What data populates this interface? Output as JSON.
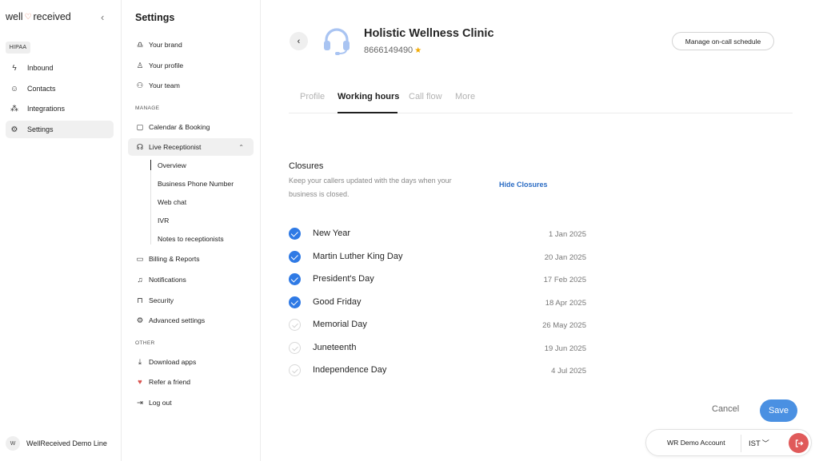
{
  "brand": {
    "logo_text_left": "well",
    "logo_text_right": "received",
    "hipaa": "HIPAA"
  },
  "leftnav": {
    "items": [
      {
        "label": "Inbound",
        "icon": "bolt-icon"
      },
      {
        "label": "Contacts",
        "icon": "smiley-icon"
      },
      {
        "label": "Integrations",
        "icon": "grid-icon"
      },
      {
        "label": "Settings",
        "icon": "gear-icon",
        "active": true
      }
    ],
    "user": {
      "initial": "W",
      "name": "WellReceived Demo Line"
    }
  },
  "settings": {
    "title": "Settings",
    "top_items": [
      "Your brand",
      "Your profile",
      "Your team"
    ],
    "manage_label": "MANAGE",
    "manage_items": [
      "Calendar & Booking",
      "Live Receptionist"
    ],
    "sub_items": [
      "Overview",
      "Business Phone Number",
      "Web chat",
      "IVR",
      "Notes to receptionists"
    ],
    "more_manage": [
      "Billing & Reports",
      "Notifications",
      "Security",
      "Advanced settings"
    ],
    "other_label": "OTHER",
    "other_items": [
      "Download apps",
      "Refer a friend",
      "Log out"
    ]
  },
  "main": {
    "clinic_name": "Holistic Wellness Clinic",
    "phone": "8666149490",
    "oncall_button": "Manage on-call schedule",
    "tabs": [
      "Profile",
      "Working hours",
      "Call flow",
      "More"
    ],
    "active_tab": "Working hours",
    "closures": {
      "title": "Closures",
      "description": "Keep your callers updated with the days when your business is closed.",
      "hide_link": "Hide Closures",
      "holidays": [
        {
          "name": "New Year",
          "date": "1 Jan 2025",
          "checked": true
        },
        {
          "name": "Martin Luther King Day",
          "date": "20 Jan 2025",
          "checked": true
        },
        {
          "name": "President's Day",
          "date": "17 Feb 2025",
          "checked": true
        },
        {
          "name": "Good Friday",
          "date": "18 Apr 2025",
          "checked": true
        },
        {
          "name": "Memorial Day",
          "date": "26 May 2025",
          "checked": false
        },
        {
          "name": "Juneteenth",
          "date": "19 Jun 2025",
          "checked": false
        },
        {
          "name": "Independence Day",
          "date": "4 Jul 2025",
          "checked": false
        }
      ]
    },
    "cancel": "Cancel",
    "save": "Save",
    "account": {
      "name": "WR Demo Account",
      "timezone": "IST"
    }
  },
  "colors": {
    "accent_blue": "#2f7ae5",
    "save_blue": "#4a90e2",
    "link_blue": "#2b6cc4",
    "star": "#f2a900",
    "logout_red": "#e05a5a"
  }
}
